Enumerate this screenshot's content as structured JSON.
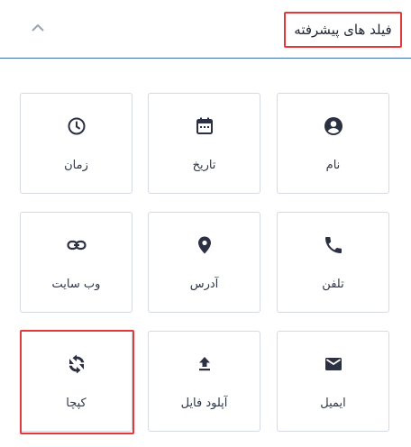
{
  "header": {
    "title": "فیلد های پیشرفته",
    "toggle_icon": "chevron-up-icon"
  },
  "fields": [
    {
      "label": "نام",
      "icon": "account-circle-icon"
    },
    {
      "label": "تاریخ",
      "icon": "calendar-icon"
    },
    {
      "label": "زمان",
      "icon": "clock-icon"
    },
    {
      "label": "تلفن",
      "icon": "phone-icon"
    },
    {
      "label": "آدرس",
      "icon": "map-pin-icon"
    },
    {
      "label": "وب سایت",
      "icon": "link-icon"
    },
    {
      "label": "ایمیل",
      "icon": "email-icon"
    },
    {
      "label": "آپلود فایل",
      "icon": "upload-icon"
    },
    {
      "label": "کپچا",
      "icon": "captcha-icon"
    }
  ],
  "colors": {
    "accent_line": "#3e73a8",
    "highlight": "#e5383b",
    "icon": "#2b3042",
    "tile_border": "#d5d9e2"
  }
}
